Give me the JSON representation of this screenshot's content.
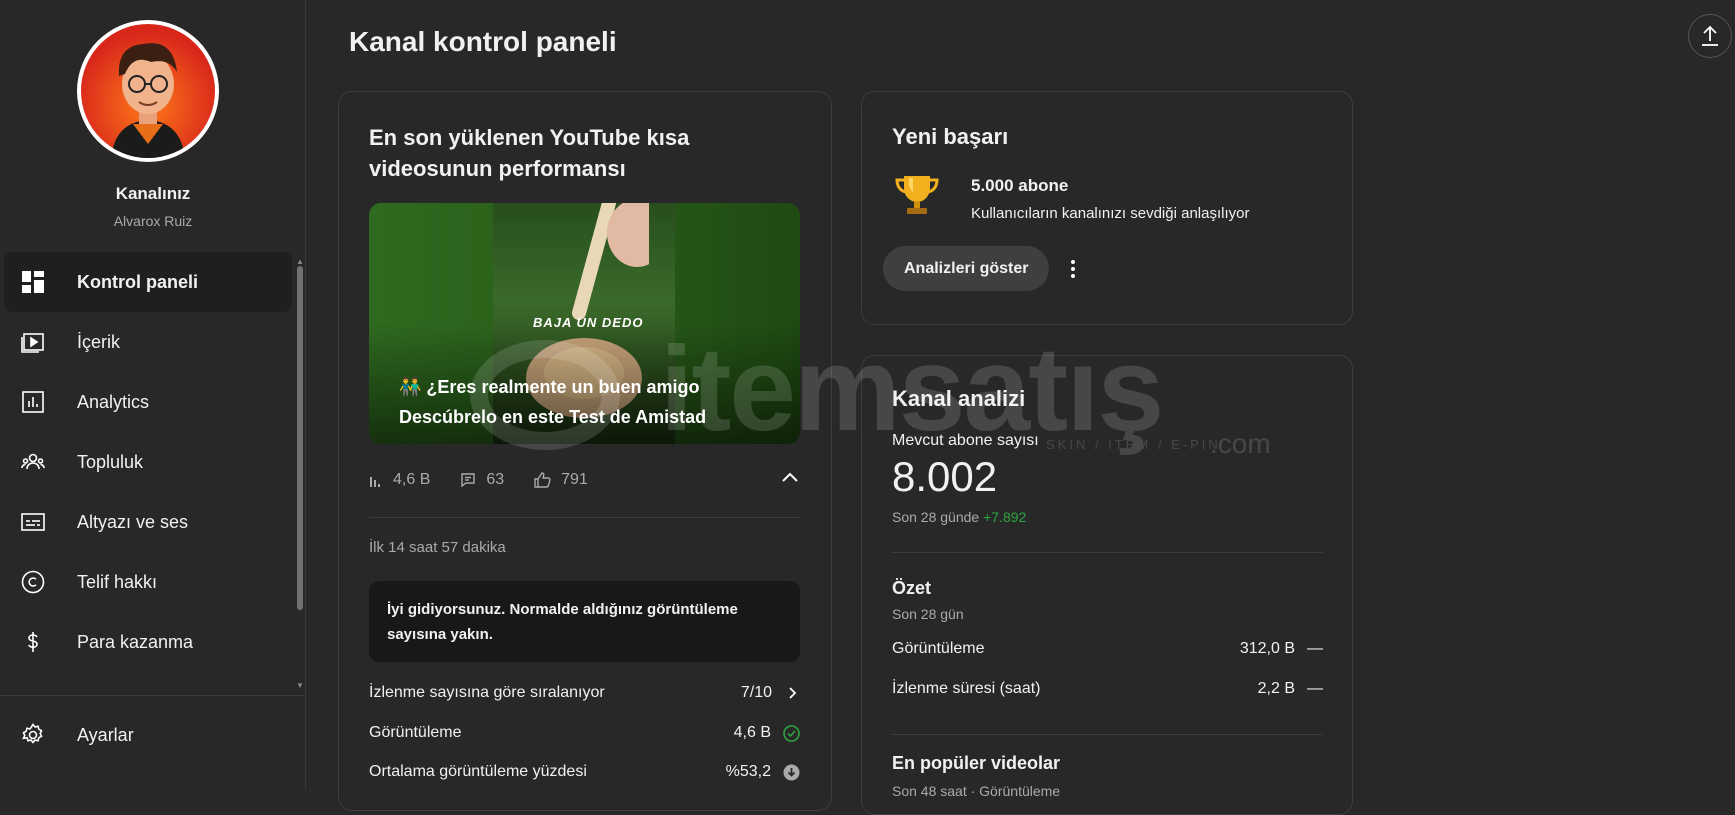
{
  "channel": {
    "title": "Kanalınız",
    "handle": "Alvarox Ruiz"
  },
  "nav": {
    "items": [
      {
        "label": "Kontrol paneli",
        "icon": "dashboard-icon",
        "active": true
      },
      {
        "label": "İçerik",
        "icon": "content-icon"
      },
      {
        "label": "Analytics",
        "icon": "analytics-icon"
      },
      {
        "label": "Topluluk",
        "icon": "community-icon"
      },
      {
        "label": "Altyazı ve ses",
        "icon": "subtitles-icon"
      },
      {
        "label": "Telif hakkı",
        "icon": "copyright-icon"
      },
      {
        "label": "Para kazanma",
        "icon": "dollar-icon"
      }
    ],
    "settings": "Ayarlar"
  },
  "page": {
    "title": "Kanal kontrol paneli"
  },
  "latest_short": {
    "title": "En son yüklenen YouTube kısa videosunun performansı",
    "thumbnail_tag": "BAJA UN DEDO",
    "caption_line1": "👬 ¿Eres realmente un buen amigo",
    "caption_line2": "Descúbrelo en este Test de Amistad",
    "views": "4,6 B",
    "comments": "63",
    "likes": "791",
    "elapsed": "İlk 14 saat 57 dakika",
    "note": "İyi gidiyorsunuz. Normalde aldığınız görüntüleme sayısına yakın.",
    "metrics": [
      {
        "label": "İzlenme sayısına göre sıralanıyor",
        "value": "7/10",
        "indicator": "chevron-right-icon"
      },
      {
        "label": "Görüntüleme",
        "value": "4,6 B",
        "indicator": "check-circle-icon"
      },
      {
        "label": "Ortalama görüntüleme yüzdesi",
        "value": "%53,2",
        "indicator": "down-circle-icon"
      }
    ]
  },
  "achievement": {
    "title": "Yeni başarı",
    "headline": "5.000 abone",
    "subtitle": "Kullanıcıların kanalınızı sevdiği anlaşılıyor",
    "button": "Analizleri göster"
  },
  "analytics": {
    "title": "Kanal analizi",
    "subscribers_label": "Mevcut abone sayısı",
    "subscribers_value": "8.002",
    "delta_label": "Son 28 günde",
    "delta_value": "+7.892",
    "summary_title": "Özet",
    "summary_period": "Son 28 gün",
    "summary_rows": [
      {
        "label": "Görüntüleme",
        "value": "312,0 B",
        "trend": "—"
      },
      {
        "label": "İzlenme süresi (saat)",
        "value": "2,2 B",
        "trend": "—"
      }
    ],
    "popular_title": "En popüler videolar",
    "popular_sub": "Son 48 saat · Görüntüleme"
  },
  "watermark": {
    "main": "itemsatış",
    "tagline": "SKIN / ITEM / E-PIN",
    "suffix": ".com"
  },
  "colors": {
    "background": "#282828",
    "positive": "#2ba640",
    "card_border": "#3d3d3d"
  }
}
